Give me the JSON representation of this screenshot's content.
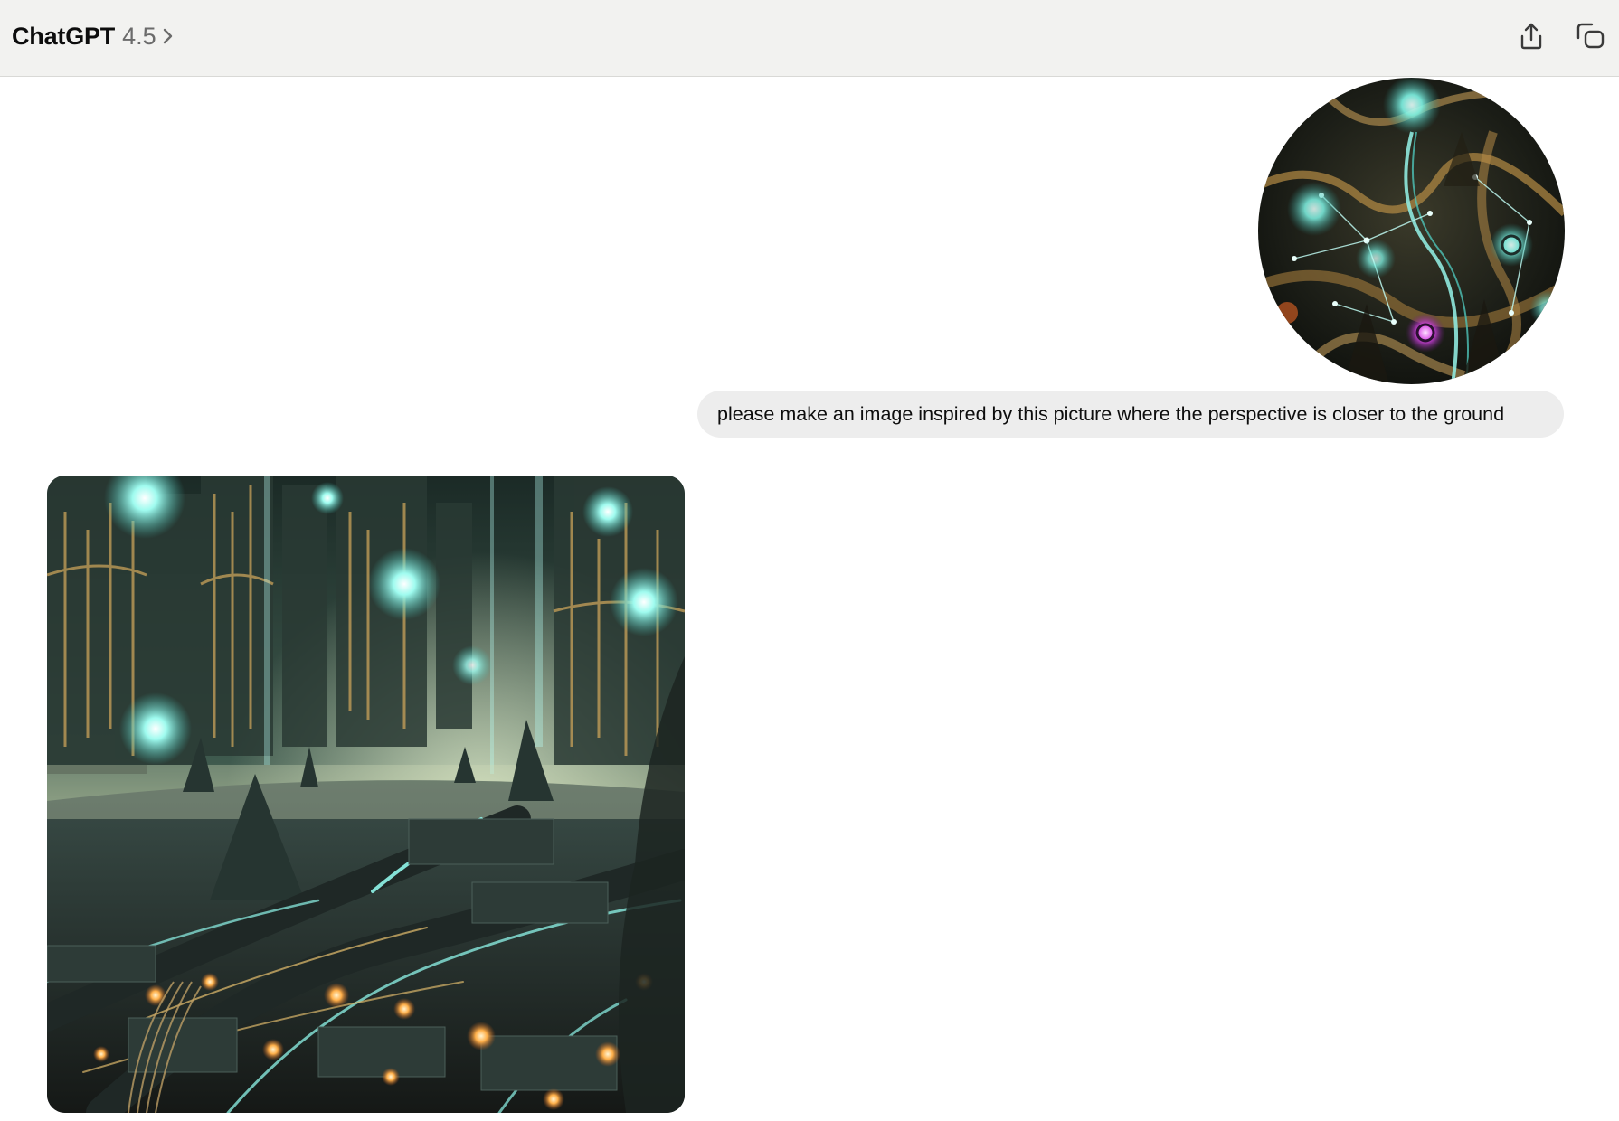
{
  "header": {
    "app_name": "ChatGPT",
    "model_version": "4.5",
    "share_icon": "share-upload-icon",
    "new_chat_icon": "new-chat-icon"
  },
  "conversation": {
    "user_message": {
      "attachment_icon": "user-uploaded-image",
      "text": "please make an image inspired by this picture where the perspective is closer to the ground"
    },
    "assistant_message": {
      "image_icon": "generated-image"
    }
  },
  "colors": {
    "topbar_bg": "#f2f2f0",
    "bubble_bg": "#ededed",
    "teal_glow": "#7ff5e6",
    "gold": "#c9a25a",
    "orange_glow": "#ffb04a"
  }
}
